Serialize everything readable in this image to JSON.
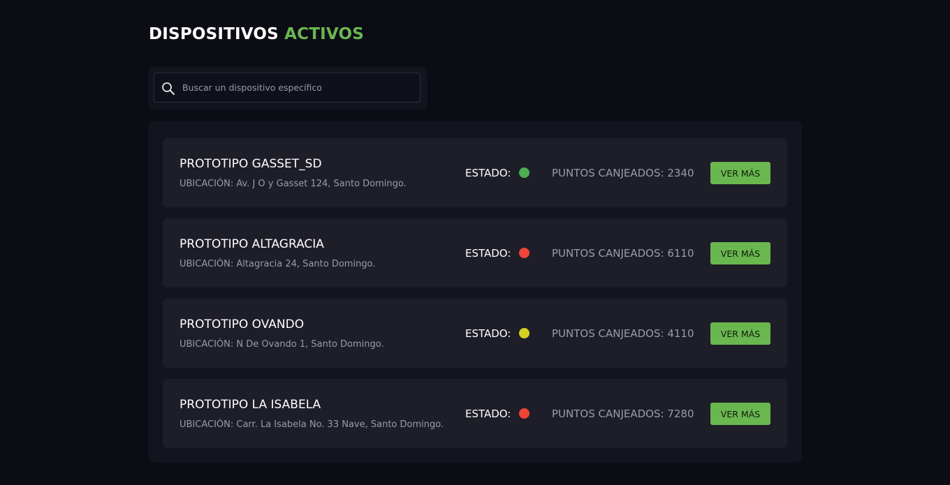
{
  "header": {
    "title_main": "DISPOSITIVOS",
    "title_accent": "ACTIVOS"
  },
  "search": {
    "placeholder": "Buscar un dispositivo específico",
    "icon": "search-icon"
  },
  "colors": {
    "accent": "#6ab750",
    "status_green": "#4caf50",
    "status_red": "#f04438",
    "status_yellow": "#d4d11e"
  },
  "devices": [
    {
      "name": "PROTOTIPO GASSET_SD",
      "location": "UBICACIÓN: Av. J O y Gasset 124, Santo Domingo.",
      "status_label": "ESTADO:",
      "status_color": "#4caf50",
      "points": "PUNTOS CANJEADOS: 2340",
      "button_label": "VER MÁS"
    },
    {
      "name": "PROTOTIPO ALTAGRACIA",
      "location": "UBICACIÓN: Altagracia 24, Santo Domingo.",
      "status_label": "ESTADO:",
      "status_color": "#f04438",
      "points": "PUNTOS CANJEADOS: 6110",
      "button_label": "VER MÁS"
    },
    {
      "name": "PROTOTIPO OVANDO",
      "location": "UBICACIÓN: N De Ovando 1, Santo Domingo.",
      "status_label": "ESTADO:",
      "status_color": "#d4d11e",
      "points": "PUNTOS CANJEADOS: 4110",
      "button_label": "VER MÁS"
    },
    {
      "name": "PROTOTIPO LA ISABELA",
      "location": "UBICACIÓN: Carr. La Isabela No. 33 Nave, Santo Domingo.",
      "status_label": "ESTADO:",
      "status_color": "#f04438",
      "points": "PUNTOS CANJEADOS: 7280",
      "button_label": "VER MÁS"
    }
  ]
}
